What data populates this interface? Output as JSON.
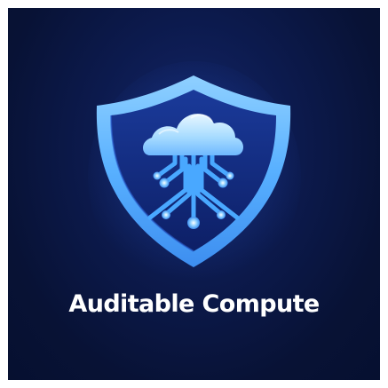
{
  "brand": {
    "name": "Auditable Compute"
  },
  "colors": {
    "background": "#0c1a4d",
    "shield": "#5cb4ff",
    "circuit": "#49a8ff",
    "cloud": "#bfe6ff",
    "text": "#ffffff"
  },
  "icons": {
    "logo": "shield-cloud-circuit-icon"
  }
}
